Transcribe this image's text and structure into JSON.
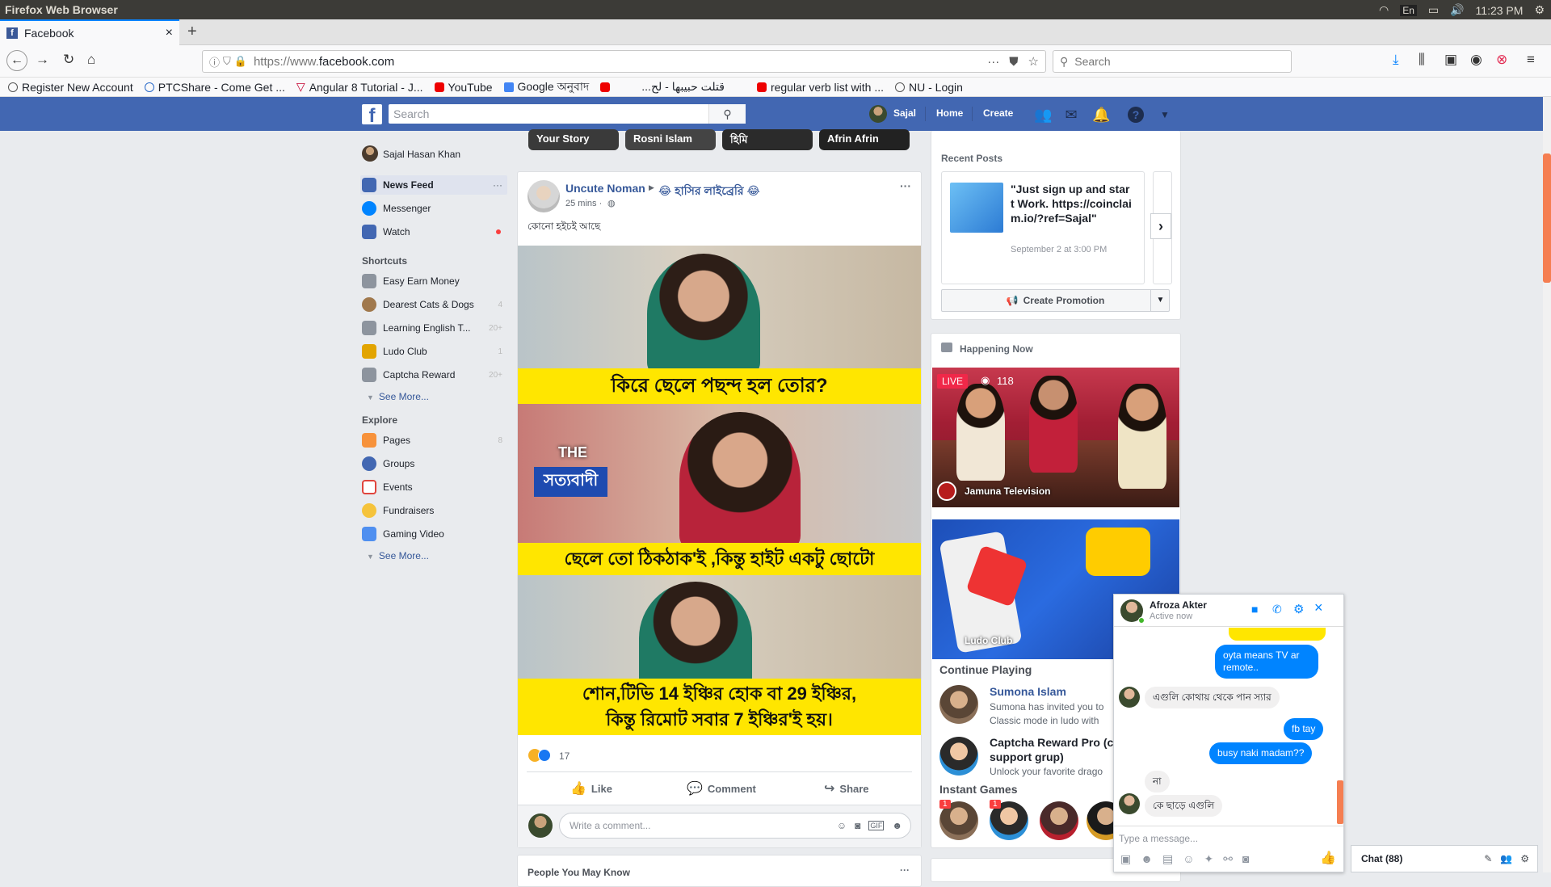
{
  "os": {
    "title": "Firefox Web Browser",
    "lang": "En",
    "time": "11:23 PM"
  },
  "browser": {
    "tab_title": "Facebook",
    "url_prefix": "https://www.",
    "url_domain": "facebook.com",
    "search_placeholder": "Search",
    "bookmarks": [
      {
        "label": "Register New Account"
      },
      {
        "label": "PTCShare - Come Get ..."
      },
      {
        "label": "Angular 8 Tutorial - J..."
      },
      {
        "label": "YouTube"
      },
      {
        "label": "Google অনুবাদ"
      },
      {
        "label": ""
      },
      {
        "label": "...قتلت حبيبها - لح"
      },
      {
        "label": "regular verb list with ..."
      },
      {
        "label": "NU - Login"
      }
    ]
  },
  "fb": {
    "search_placeholder": "Search",
    "user_short": "Sajal",
    "nav_home": "Home",
    "nav_create": "Create",
    "user_full": "Sajal Hasan Khan",
    "left": {
      "main": [
        {
          "label": "News Feed",
          "more": "···"
        },
        {
          "label": "Messenger"
        },
        {
          "label": "Watch"
        }
      ],
      "shortcuts_head": "Shortcuts",
      "shortcuts": [
        {
          "label": "Easy Earn Money",
          "count": ""
        },
        {
          "label": "Dearest Cats & Dogs",
          "count": "4"
        },
        {
          "label": "Learning English T...",
          "count": "20+"
        },
        {
          "label": "Ludo Club",
          "count": "1"
        },
        {
          "label": "Captcha Reward",
          "count": "20+"
        }
      ],
      "see_more1": "See More...",
      "explore_head": "Explore",
      "explore": [
        {
          "label": "Pages",
          "count": "8"
        },
        {
          "label": "Groups",
          "count": ""
        },
        {
          "label": "Events",
          "count": ""
        },
        {
          "label": "Fundraisers",
          "count": ""
        },
        {
          "label": "Gaming Video",
          "count": ""
        }
      ],
      "see_more2": "See More..."
    },
    "stories": [
      "Your Story",
      "Rosni Islam",
      "হিমি",
      "Afrin Afrin"
    ],
    "post": {
      "author": "Uncute Noman",
      "group": "😂 হাসির লাইব্রেরি 😂",
      "time": "25 mins ·",
      "text": "কোনো হইচই আছে",
      "cap1": "কিরে ছেলে পছন্দ হল তোর?",
      "watermark1": "THE",
      "watermark2": "সত্যবাদী",
      "cap2": "ছেলে তো ঠিকঠাক'ই ,কিন্তু হাইট একটু ছোটো",
      "cap3a": "শোন,টিভি 14 ইঞ্চির হোক বা 29 ইঞ্চির,",
      "cap3b": "কিন্তু রিমোট সবার 7 ইঞ্চির'ই হয়।",
      "reaction_count": "17",
      "like": "Like",
      "comment": "Comment",
      "share": "Share",
      "comment_placeholder": "Write a comment..."
    },
    "next_card_title": "People You May Know",
    "right": {
      "recent_posts": "Recent Posts",
      "post_text": "\"Just sign up and start Work. https://coinclaim.io/?ref=Sajal\"",
      "post_date": "September 2 at 3:00 PM",
      "create_promotion": "Create Promotion",
      "happening_now": "Happening Now",
      "live_badge": "LIVE",
      "live_viewers": "118",
      "live_channel": "Jamuna Television",
      "ludo_label": "Ludo Club",
      "continue_playing": "Continue Playing",
      "games": [
        {
          "title": "Sumona Islam",
          "sub1": "Sumona has invited you to",
          "sub2": "Classic mode in ludo with"
        },
        {
          "title": "Captcha Reward Pro (c",
          "title2": "support grup)",
          "sub1": "Unlock your favorite drago"
        }
      ],
      "instant_games": "Instant Games",
      "badges": [
        "1",
        "1"
      ]
    },
    "chat": {
      "name": "Afroza Akter",
      "status": "Active now",
      "messages": [
        {
          "from": "me",
          "text": "oyta means TV ar remote.."
        },
        {
          "from": "them",
          "text": "এগুলি কোথায় থেকে পান স্যার"
        },
        {
          "from": "me",
          "text": "fb tay"
        },
        {
          "from": "me",
          "text": "busy naki madam??"
        },
        {
          "from": "them",
          "text": "না"
        },
        {
          "from": "them",
          "text": "কে ছাড়ে এগুলি"
        }
      ],
      "input_placeholder": "Type a message...",
      "dock_label": "Chat (88)"
    }
  }
}
